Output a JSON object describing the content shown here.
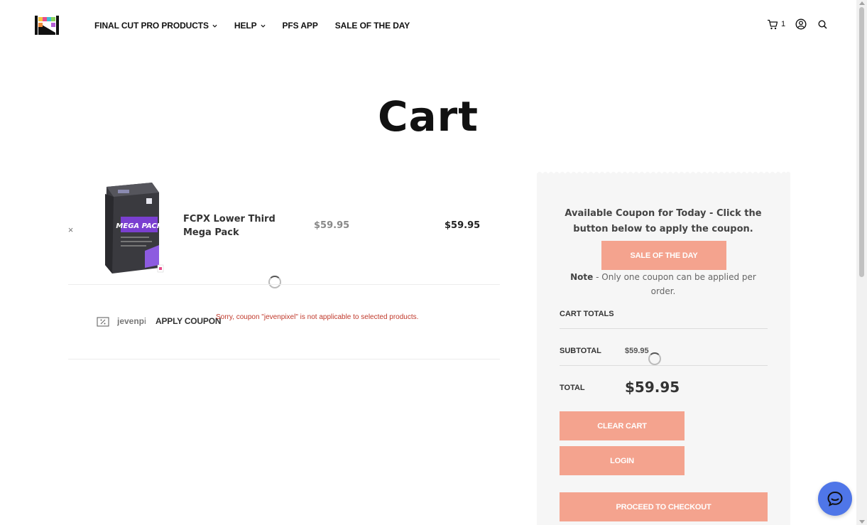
{
  "header": {
    "nav": [
      {
        "label": "FINAL CUT PRO PRODUCTS",
        "has_dropdown": true
      },
      {
        "label": "HELP",
        "has_dropdown": true
      },
      {
        "label": "PFS APP",
        "has_dropdown": false
      },
      {
        "label": "SALE OF THE DAY",
        "has_dropdown": false
      }
    ],
    "cart_count": "1",
    "icons": [
      "cart-icon",
      "account-icon",
      "search-icon"
    ]
  },
  "page": {
    "title": "Cart"
  },
  "cart": {
    "items": [
      {
        "remove_symbol": "×",
        "name": "FCPX Lower Third Mega Pack",
        "price": "$59.95",
        "subtotal": "$59.95",
        "image_text": "MEGA PACK"
      }
    ],
    "coupon": {
      "input_value": "jevenpixel",
      "apply_label": "APPLY COUPON",
      "error": "Sorry, coupon \"jevenpixel\" is not applicable to selected products."
    }
  },
  "sidebar": {
    "coupon_title": "Available Coupon for Today - Click the button below to apply the coupon.",
    "sale_button": "SALE OF THE DAY",
    "note_label": "Note",
    "note_text": " - Only one coupon can be applied per order.",
    "totals_heading": "CART TOTALS",
    "subtotal_label": "SUBTOTAL",
    "subtotal_value": "$59.95",
    "total_label": "TOTAL",
    "total_value": "$59.95",
    "clear_cart": "CLEAR CART",
    "login": "LOGIN",
    "checkout": "PROCEED TO CHECKOUT"
  },
  "colors": {
    "button": "#f4a38e",
    "chat": "#4f76e8",
    "error": "#c0392b",
    "panel": "#f6f6f6"
  }
}
